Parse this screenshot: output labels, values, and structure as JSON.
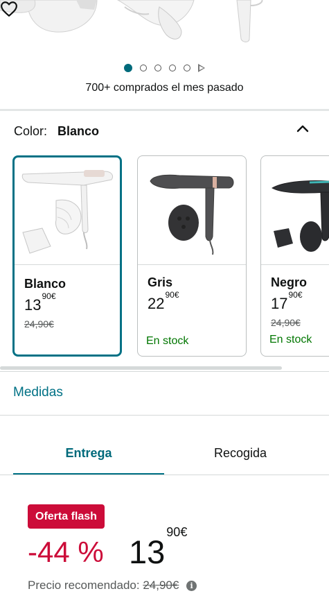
{
  "carousel": {
    "dots": 5,
    "active_index": 0,
    "bought_text": "700+ comprados el mes pasado"
  },
  "color": {
    "label": "Color:",
    "selected": "Blanco"
  },
  "variants": [
    {
      "name": "Blanco",
      "price_whole": "13",
      "price_fraction": "90",
      "currency": "€",
      "old_price": "24,90€",
      "stock": ""
    },
    {
      "name": "Gris",
      "price_whole": "22",
      "price_fraction": "90",
      "currency": "€",
      "old_price": "",
      "stock": "En stock"
    },
    {
      "name": "Negro",
      "price_whole": "17",
      "price_fraction": "90",
      "currency": "€",
      "old_price": "24,90€",
      "stock": "En stock"
    }
  ],
  "medidas": {
    "label": "Medidas"
  },
  "tabs": [
    {
      "label": "Entrega",
      "active": true
    },
    {
      "label": "Recogida",
      "active": false
    }
  ],
  "offer": {
    "badge": "Oferta flash",
    "discount": "-44 %",
    "price_whole": "13",
    "price_fraction": "90",
    "currency": "€",
    "recommended_label": "Precio recomendado:",
    "recommended_price": "24,90€",
    "info_glyph": "i"
  },
  "colors": {
    "accent": "#007185",
    "deal_red": "#cc0c39",
    "stock_green": "#007600"
  },
  "icons": [
    "heart-icon",
    "chevron-up-icon",
    "info-icon",
    "play-icon"
  ]
}
